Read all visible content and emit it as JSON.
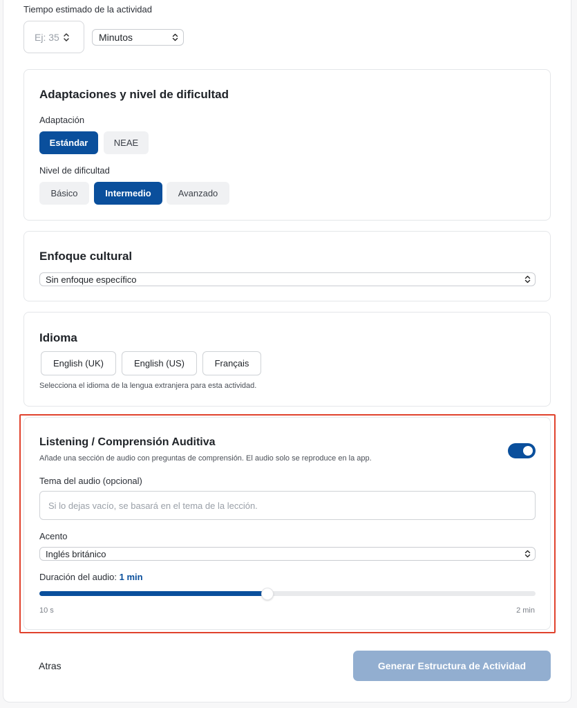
{
  "time": {
    "label": "Tiempo estimado de la actividad",
    "placeholder": "Ej: 35",
    "unit": "Minutos"
  },
  "adaptations": {
    "title": "Adaptaciones y nivel de dificultad",
    "adaptation_label": "Adaptación",
    "adaptation_options": [
      "Estándar",
      "NEAE"
    ],
    "adaptation_selected": "Estándar",
    "difficulty_label": "Nivel de dificultad",
    "difficulty_options": [
      "Básico",
      "Intermedio",
      "Avanzado"
    ],
    "difficulty_selected": "Intermedio"
  },
  "cultural": {
    "title": "Enfoque cultural",
    "selected": "Sin enfoque específico"
  },
  "language": {
    "title": "Idioma",
    "options": [
      "English (UK)",
      "English (US)",
      "Français"
    ],
    "hint": "Selecciona el idioma de la lengua extranjera para esta actividad."
  },
  "listening": {
    "title": "Listening / Comprensión Auditiva",
    "description": "Añade una sección de audio con preguntas de comprensión. El audio solo se reproduce en la app.",
    "enabled": true,
    "topic_label": "Tema del audio (opcional)",
    "topic_placeholder": "Si lo dejas vacío, se basará en el tema de la lección.",
    "accent_label": "Acento",
    "accent_selected": "Inglés británico",
    "duration_label": "Duración del audio:",
    "duration_value": "1 min",
    "duration_fraction": 0.46,
    "range_min": "10 s",
    "range_max": "2 min"
  },
  "footer": {
    "back_label": "Atras",
    "generate_label": "Generar Estructura de Actividad"
  },
  "colors": {
    "primary": "#0a4f9c",
    "highlight": "#e0412c",
    "disabled_button": "#92aed0"
  }
}
